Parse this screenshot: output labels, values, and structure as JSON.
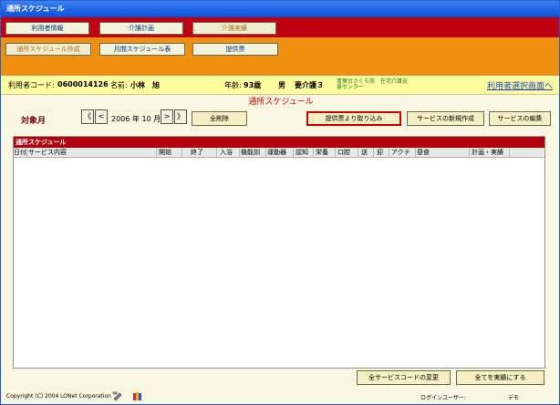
{
  "window": {
    "title": "通所スケジュール"
  },
  "nav": {
    "row1": [
      {
        "label": "利用者情報",
        "active": false
      },
      {
        "label": "介護計画",
        "active": false
      },
      {
        "label": "介護実績",
        "active": true
      }
    ],
    "row2": [
      {
        "label": "通所スケジュール作成",
        "active": true
      },
      {
        "label": "月間スケジュール表",
        "active": false
      },
      {
        "label": "提供票",
        "active": false
      }
    ]
  },
  "info": {
    "user_code_label": "利用者コード:",
    "user_code": "0600014126",
    "name_label": "名前:",
    "name": "小林　旭",
    "age_label": "年齢:",
    "age": "93歳",
    "sex": "男",
    "care_level": "要介護３",
    "facility_line1": "青葉台さくら苑　在宅介護支",
    "facility_line2": "援センター",
    "select_link": "利用者選択画面へ"
  },
  "screen_title": "通所スケジュール",
  "controls": {
    "target_month_label": "対象月",
    "prev_year": "《",
    "prev_month": "<",
    "next_month": ">",
    "next_year": "》",
    "year": "2006",
    "year_unit": "年",
    "month": "10",
    "month_unit": "月",
    "delete_all": "全削除",
    "import_from_sheet": "提供票より取り込み",
    "new_service": "サービスの新規作成",
    "edit_service": "サービスの編集"
  },
  "schedule": {
    "title": "通所スケジュール",
    "columns": [
      "日付",
      "サービス内容",
      "開始",
      "終了",
      "入浴",
      "機能訓",
      "運動器",
      "認知",
      "栄養",
      "口腔",
      "送",
      "迎",
      "アクテ",
      "昼食",
      "計画・実績"
    ]
  },
  "bottom": {
    "change_all_codes": "全サービスコードの変更",
    "mark_all_actual": "全てを実績にする"
  },
  "status": {
    "copyright": "Copyright (C) 2004 LONet Corporation",
    "login_label": "ログインユーザー:",
    "login_user": "デモ"
  },
  "colors": {
    "nav_red": "#c00010",
    "nav_orange": "#ee8f10",
    "info_yellow": "#ffffa0",
    "title_red": "#cc0000",
    "highlight_red": "#d00000"
  }
}
